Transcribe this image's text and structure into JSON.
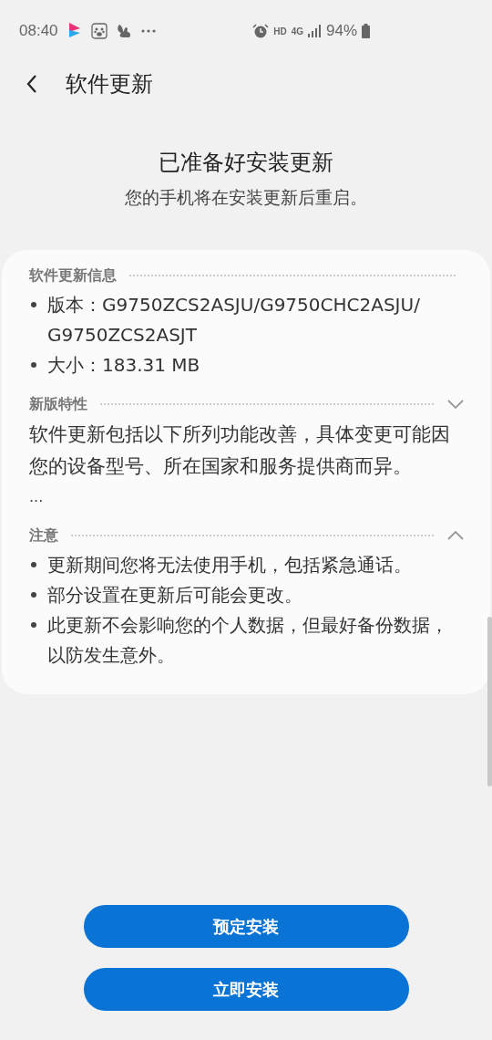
{
  "status_bar": {
    "time": "08:40",
    "hd": "HD",
    "network": "4G",
    "battery": "94%"
  },
  "header": {
    "title": "软件更新"
  },
  "intro": {
    "title": "已准备好安装更新",
    "subtitle": "您的手机将在安装更新后重启。"
  },
  "sections": [
    {
      "kind": "info",
      "title": "软件更新信息",
      "bullets": [
        "版本：G9750ZCS2ASJU/G9750CHC2ASJU/ G9750ZCS2ASJT",
        "大小：183.31 MB"
      ]
    },
    {
      "kind": "collapsible",
      "title": "新版特性",
      "expanded": false,
      "paragraph": "软件更新包括以下所列功能改善，具体变更可能因您的设备型号、所在国家和服务提供商而异。",
      "more": "..."
    },
    {
      "kind": "collapsible",
      "title": "注意",
      "expanded": true,
      "bullets": [
        "更新期间您将无法使用手机，包括紧急通话。",
        "部分设置在更新后可能会更改。",
        "此更新不会影响您的个人数据，但最好备份数据，以防发生意外。"
      ]
    }
  ],
  "buttons": [
    "预定安装",
    "立即安装"
  ]
}
